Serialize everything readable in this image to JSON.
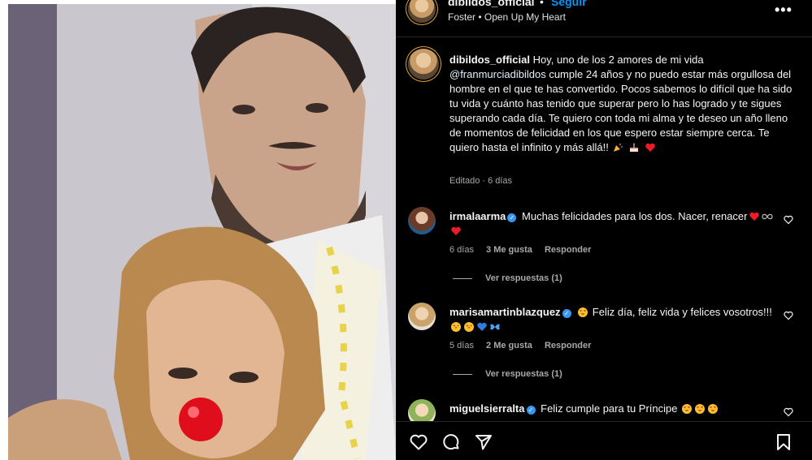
{
  "header": {
    "username": "dibildos_official",
    "separator": "•",
    "follow_label": "Seguir",
    "music": "Foster • Open Up My Heart",
    "more_icon": "more-horizontal-icon"
  },
  "caption": {
    "username": "dibildos_official",
    "text_before_mention": "Hoy, uno de los 2 amores de mi vida",
    "mention": "@franmurciadibildos",
    "text_after_mention": "cumple 24 años y no puedo estar más orgullosa del hombre en el que te has convertido. Pocos sabemos lo difícil que ha sido tu vida y cuánto has tenido que superar pero lo has logrado y te sigues superando cada día. Te quiero con toda mi alma y te deseo un año lleno de momentos de felicidad en los que espero estar siempre cerca. Te quiero hasta el infinito y más allá!!",
    "emojis": [
      "party-popper-icon",
      "birthday-cake-icon",
      "red-heart-icon"
    ],
    "meta": "Editado · 6 días"
  },
  "comments": [
    {
      "username": "irmalaarma",
      "verified": true,
      "text": "Muchas felicidades para los dos. Nacer, renacer",
      "trailing_emojis": [
        "red-heart-icon",
        "infinity-icon",
        "red-heart-icon"
      ],
      "age": "6 días",
      "likes": "3 Me gusta",
      "reply_label": "Responder",
      "view_replies": "Ver respuestas (1)"
    },
    {
      "username": "marisamartinblazquez",
      "verified": true,
      "leading_emoji": "heart-eyes-icon",
      "text": "Feliz día, feliz vida y felices vosotros!!!",
      "trailing_emojis": [
        "kiss-face-icon",
        "kiss-face-icon",
        "blue-heart-icon",
        "butterfly-icon"
      ],
      "age": "5 días",
      "likes": "2 Me gusta",
      "reply_label": "Responder",
      "view_replies": "Ver respuestas (1)"
    },
    {
      "username": "miguelsierralta",
      "verified": true,
      "text": "Feliz cumple para tu Príncipe",
      "trailing_emojis": [
        "heart-eyes-icon",
        "heart-eyes-icon",
        "heart-eyes-icon"
      ]
    }
  ],
  "actions": {
    "like_icon": "heart-icon",
    "comment_icon": "comment-icon",
    "share_icon": "send-icon",
    "save_icon": "bookmark-icon"
  },
  "colors": {
    "panel_bg": "#000000",
    "follow_blue": "#0095f6",
    "verified_blue": "#3897f0",
    "muted_text": "#a8a8a8",
    "heart_red": "#ed1c24"
  }
}
